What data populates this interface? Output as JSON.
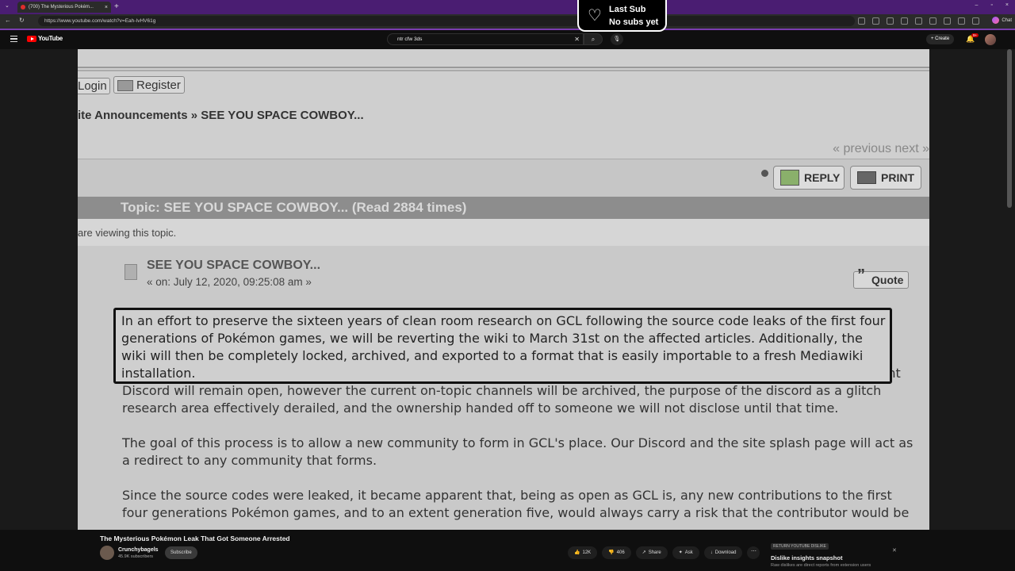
{
  "browser": {
    "tab_title": "(700) The Mysterious Pokém...",
    "url": "https://www.youtube.com/watch?v=Eah-IvHV61g",
    "chat_label": "Chat"
  },
  "youtube": {
    "logo": "YouTube",
    "search_value": "ntr cfw 3ds",
    "create_label": "Create",
    "notif_count": "9+"
  },
  "overlay": {
    "line1": "Last Sub",
    "line2": "No subs yet"
  },
  "forum": {
    "login": "Login",
    "register": "Register",
    "breadcrumb": "ite Announcements » SEE YOU SPACE COWBOY...",
    "prev_next": "« previous next »",
    "reply": "REPLY",
    "print": "PRINT",
    "topic_bar": "Topic: SEE YOU SPACE COWBOY...  (Read 2884 times)",
    "viewing": "are viewing this topic.",
    "post_title": "SEE YOU SPACE COWBOY...",
    "post_date": "« on: July 12, 2020, 09:25:08 am »",
    "quote": "Quote",
    "highlighted": "In an effort to preserve the sixteen years of clean room research on GCL following the source code leaks of the first four generations of Pokémon games, we will be reverting the wiki to March 31st on the affected articles. Additionally, the wiki will then be completely locked, archived, and exported to a format that is easily importable to a fresh Mediawiki installation.",
    "p1_rest": "Two weeks after the archival of the wiki, the forums will also be locked and archived. On July 31st, the current Discord will remain open, however the current on-topic channels will be archived, the purpose of the discord as a glitch research area effectively derailed, and the ownership handed off to someone we will not disclose until that time.",
    "p2": "The goal of this process is to allow a new community to form in GCL's place. Our Discord and the site splash page will act as a redirect to any community that forms.",
    "p3": "Since the source codes were leaked, it became apparent that, being as open as GCL is, any new contributions to the first four generations Pokémon games, and to an extent generation five, would always carry a risk that the contributor would be"
  },
  "video": {
    "title": "The Mysterious Pokémon Leak That Got Someone Arrested",
    "channel": "Crunchybagels",
    "subscribers": "45.9K subscribers",
    "subscribe_label": "Subscribe",
    "likes": "12K",
    "dislikes": "406",
    "share": "Share",
    "ask": "Ask",
    "download": "Download"
  },
  "dislike_panel": {
    "tag": "RETURN YOUTUBE DISLIKE",
    "title": "Dislike insights snapshot",
    "subtitle": "Raw dislikes are direct reports from extension users"
  }
}
